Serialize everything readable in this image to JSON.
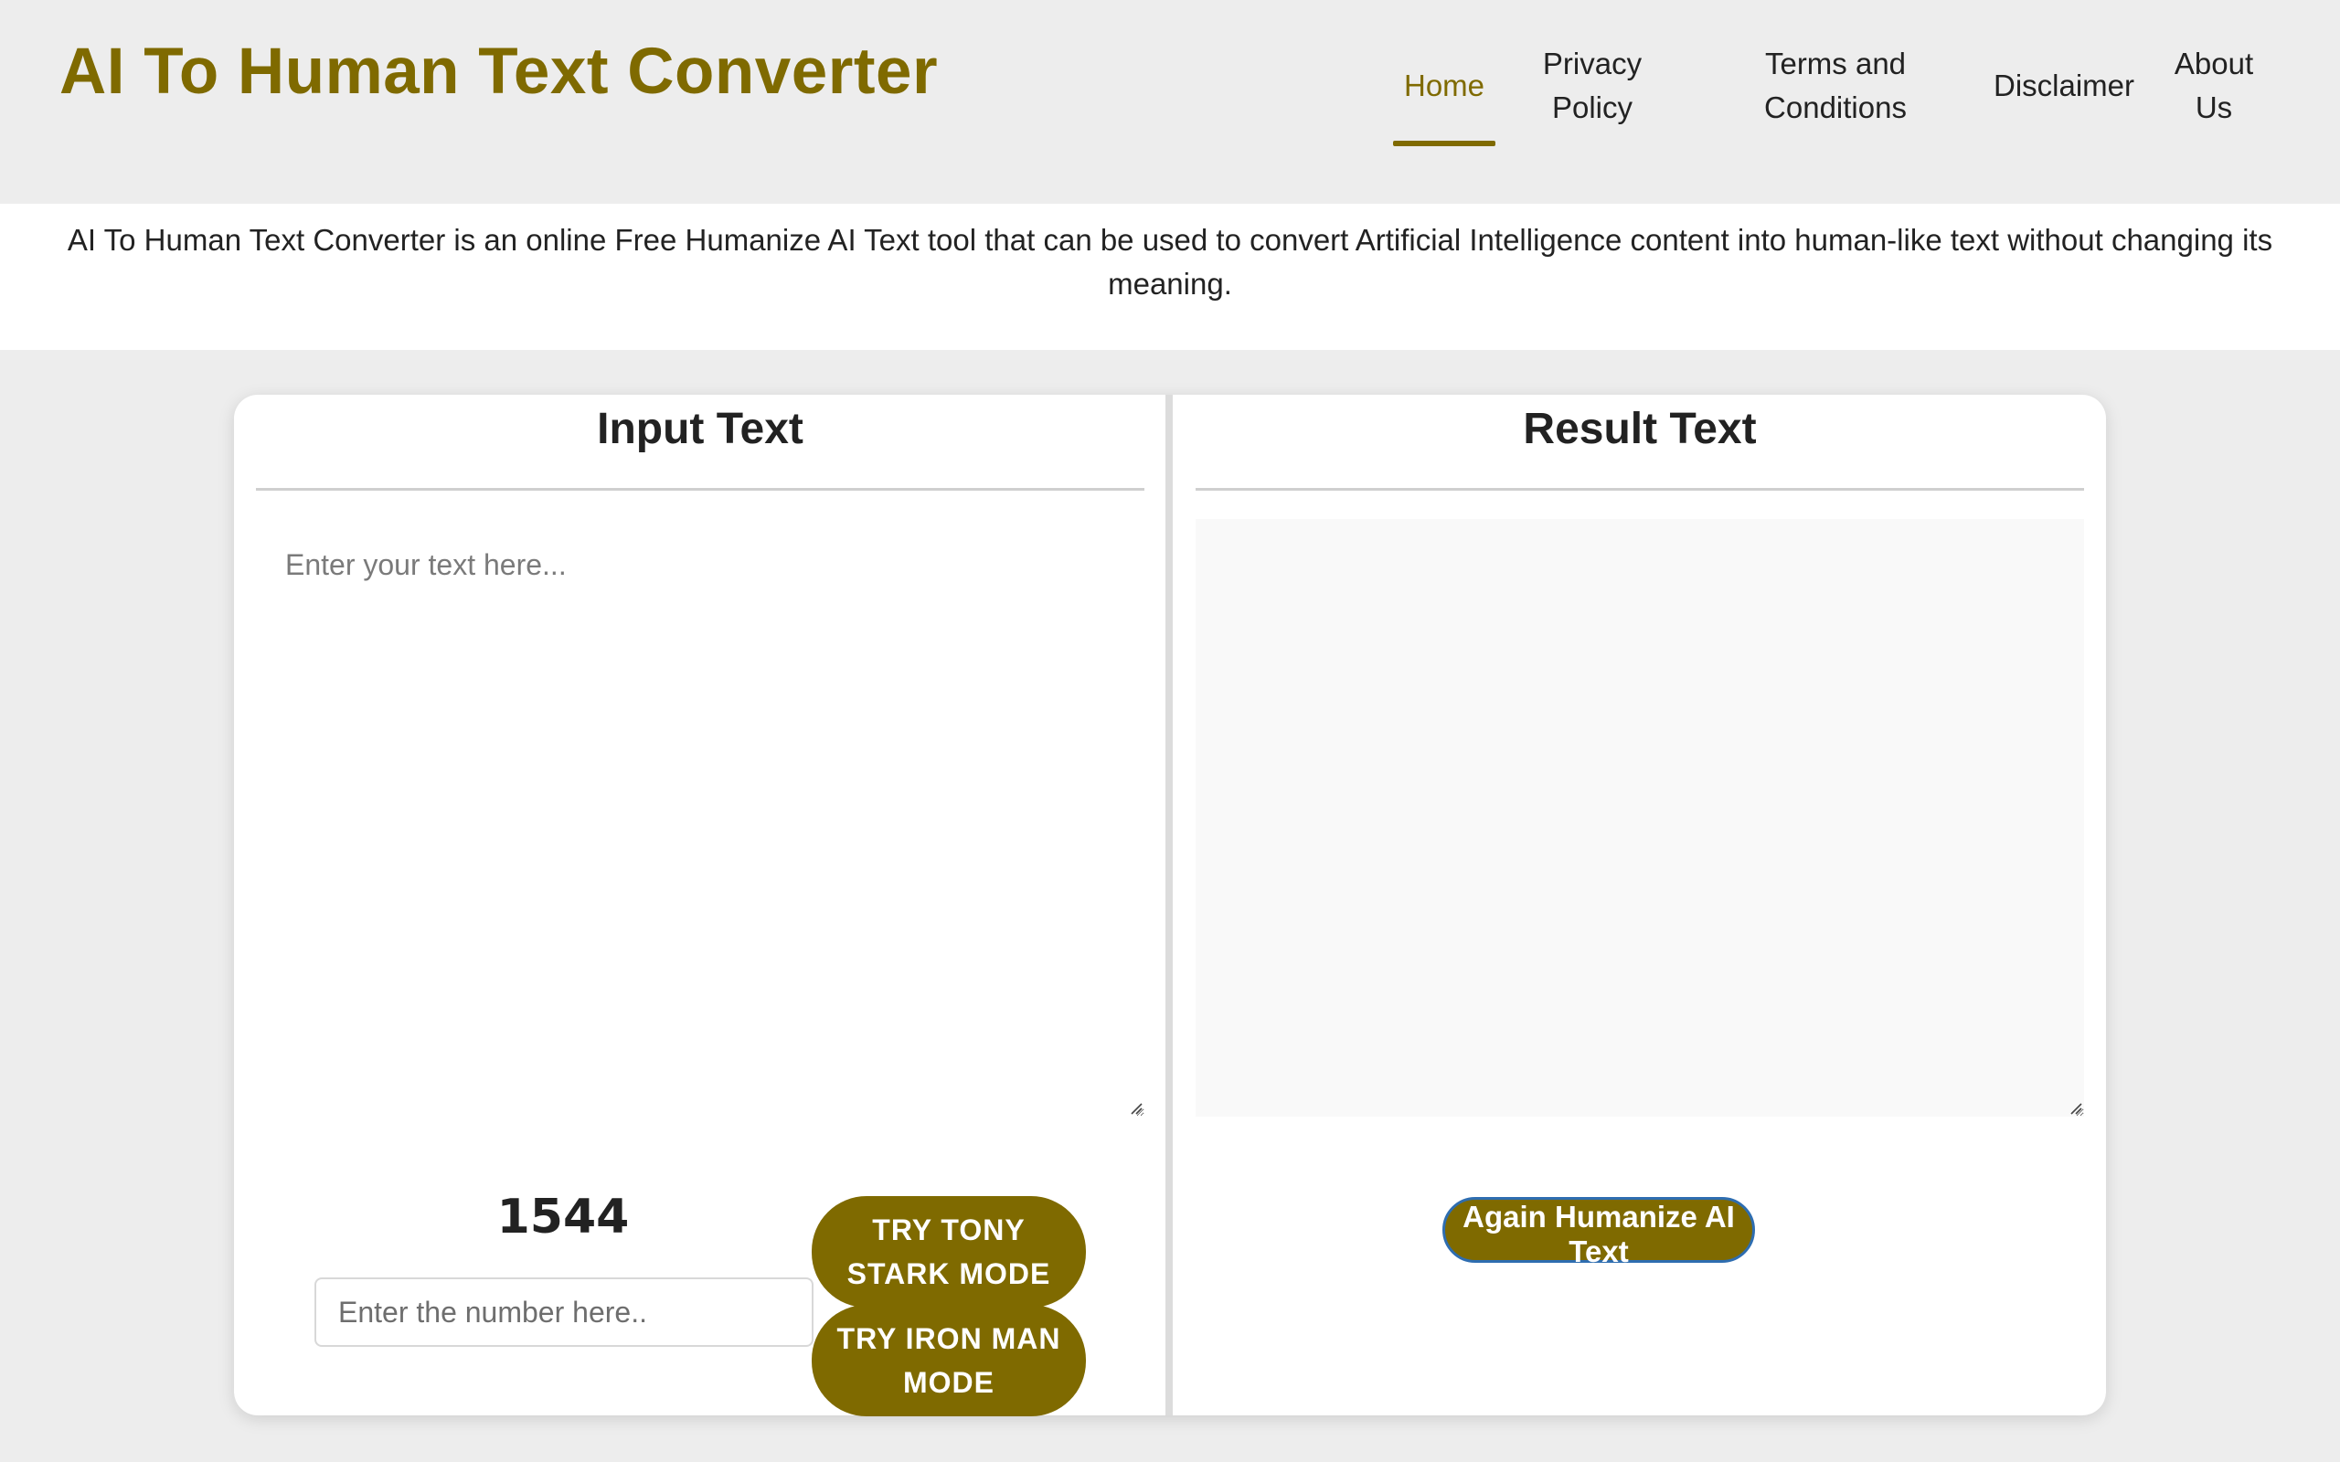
{
  "header": {
    "site_title": "AI To Human Text Converter",
    "nav": [
      {
        "label": "Home",
        "active": true
      },
      {
        "label": "Privacy Policy",
        "active": false
      },
      {
        "label": "Terms and Conditions",
        "active": false
      },
      {
        "label": "Disclaimer",
        "active": false
      },
      {
        "label": "About Us",
        "active": false
      }
    ]
  },
  "description": "AI To Human Text Converter is an online Free Humanize AI Text tool that can be used to convert Artificial Intelligence content into human-like text without changing its meaning.",
  "input_panel": {
    "title": "Input Text",
    "placeholder": "Enter your text here...",
    "counter": "1544",
    "number_placeholder": "Enter the number here..",
    "tony_button": "TRY TONY STARK MODE",
    "iron_button": "TRY IRON MAN MODE"
  },
  "result_panel": {
    "title": "Result Text",
    "again_button": "Again Humanize AI Text"
  },
  "colors": {
    "accent": "#7f6a00",
    "page_bg": "#ededed",
    "button_focus_border": "#2e6db0"
  }
}
